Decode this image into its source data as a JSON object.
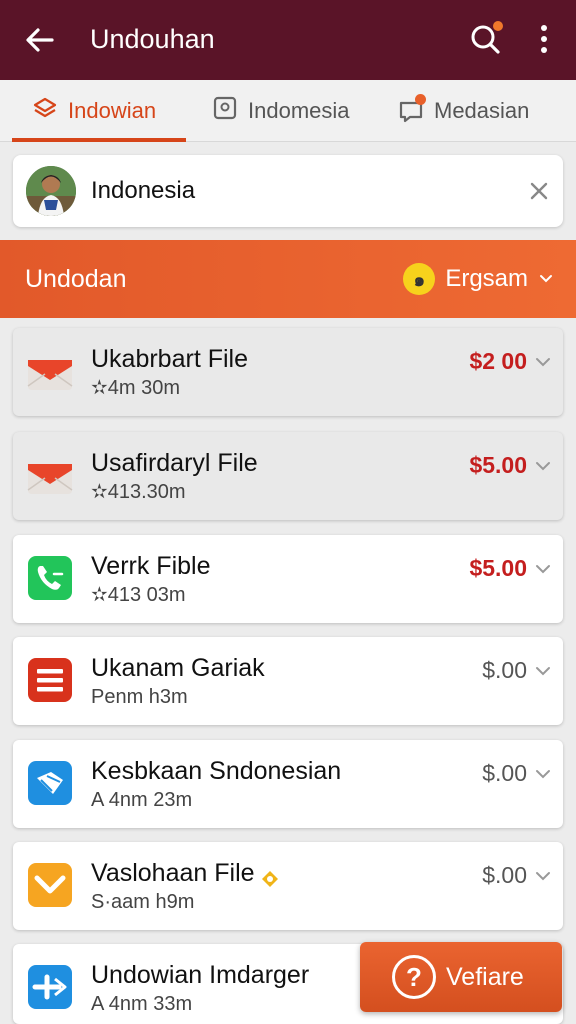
{
  "appbar": {
    "title": "Undouhan",
    "icons": [
      "back-arrow-icon",
      "search-icon",
      "more-vertical-icon"
    ],
    "color": "#5a1428"
  },
  "tabs": [
    {
      "label": "Indowian",
      "icon": "layers-icon",
      "active": true
    },
    {
      "label": "Indomesia",
      "icon": "image-icon",
      "active": false
    },
    {
      "label": "Medasian",
      "icon": "chat-icon",
      "active": false
    }
  ],
  "search": {
    "value": "Indonesia",
    "icon": "clear-icon"
  },
  "banner": {
    "label": "Undodan",
    "filter_label": "Ergsam",
    "filter_icon_glyph": "๑",
    "color": "#e2592a"
  },
  "items": [
    {
      "name": "Ukabrbart File",
      "meta": "✫4m 30m",
      "price": "$2 00",
      "icon": "mail-icon"
    },
    {
      "name": "Usafirdaryl File",
      "meta": "✫413.30m",
      "price": "$5.00",
      "icon": "mail-icon"
    },
    {
      "name": "Verrk Fible",
      "meta": "✫413 03m",
      "price": "$5.00",
      "icon": "phone-icon"
    },
    {
      "name": "Ukanam Gariak",
      "meta": "Penm h3m",
      "price": "$.00",
      "icon": "list-icon"
    },
    {
      "name": "Kesbkaan Sndonesian",
      "meta": "A 4nm 23m",
      "price": "$.00",
      "icon": "mail-open-icon"
    },
    {
      "name": "Vaslohaan File",
      "meta": "S·aam h9m",
      "price": "$.00",
      "icon": "chevron-box-icon"
    },
    {
      "name": "Undowian Imdarger",
      "meta": "A 4nm 33m",
      "price": "",
      "icon": "send-icon"
    }
  ],
  "fab": {
    "label": "Vefiare",
    "icon_glyph": "?"
  },
  "colors": {
    "accent": "#d64519",
    "price_red": "#c41e1e"
  }
}
